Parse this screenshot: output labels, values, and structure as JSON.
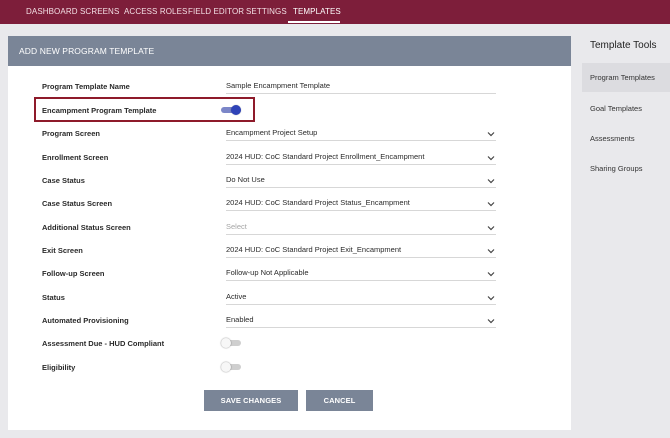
{
  "nav": {
    "items": [
      "DASHBOARD",
      "SCREENS",
      "ACCESS ROLES",
      "FIELD EDITOR",
      "SETTINGS",
      "TEMPLATES"
    ],
    "active": "TEMPLATES"
  },
  "panel": {
    "title": "ADD NEW PROGRAM TEMPLATE",
    "rows": [
      {
        "label": "Program Template Name",
        "value": "Sample Encampment Template"
      },
      {
        "label": "Encampment Program Template",
        "toggle": "on"
      },
      {
        "label": "Program Screen",
        "value": "Encampment Project Setup"
      },
      {
        "label": "Enrollment Screen",
        "value": "2024 HUD: CoC Standard Project Enrollment_Encampment"
      },
      {
        "label": "Case Status",
        "value": "Do Not Use"
      },
      {
        "label": "Case Status Screen",
        "value": "2024 HUD: CoC Standard Project Status_Encampment"
      },
      {
        "label": "Additional Status Screen",
        "placeholder": "Select"
      },
      {
        "label": "Exit Screen",
        "value": "2024 HUD: CoC Standard Project Exit_Encampment"
      },
      {
        "label": "Follow-up Screen",
        "value": "Follow-up Not Applicable"
      },
      {
        "label": "Status",
        "value": "Active"
      },
      {
        "label": "Automated Provisioning",
        "value": "Enabled"
      },
      {
        "label": "Assessment Due - HUD Compliant",
        "toggle": "off"
      },
      {
        "label": "Eligibility",
        "toggle": "off"
      }
    ],
    "save_label": "SAVE CHANGES",
    "cancel_label": "CANCEL"
  },
  "sidebar": {
    "title": "Template Tools",
    "items": [
      "Program Templates",
      "Goal Templates",
      "Assessments",
      "Sharing Groups"
    ],
    "active": "Program Templates"
  },
  "colors": {
    "nav_bg": "#7d1e3a",
    "panel_header": "#7a8597",
    "toggle_on": "#2f43b8",
    "highlight": "#8e1a2a"
  },
  "icons": {
    "dropdown": "chevron-down-icon"
  }
}
